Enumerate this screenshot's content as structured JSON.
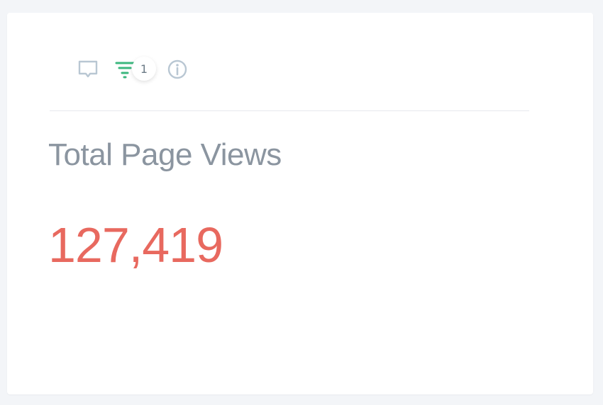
{
  "toolbar": {
    "comment_icon": "comment-icon",
    "filter_icon": "filter-icon",
    "filter_count": "1",
    "info_icon": "info-icon",
    "filter_color": "#3bb77e",
    "icon_color": "#b9c7d3"
  },
  "widget": {
    "title": "Total Page Views",
    "value": "127,419",
    "value_color": "#e8695f",
    "title_color": "#8b95a0"
  }
}
